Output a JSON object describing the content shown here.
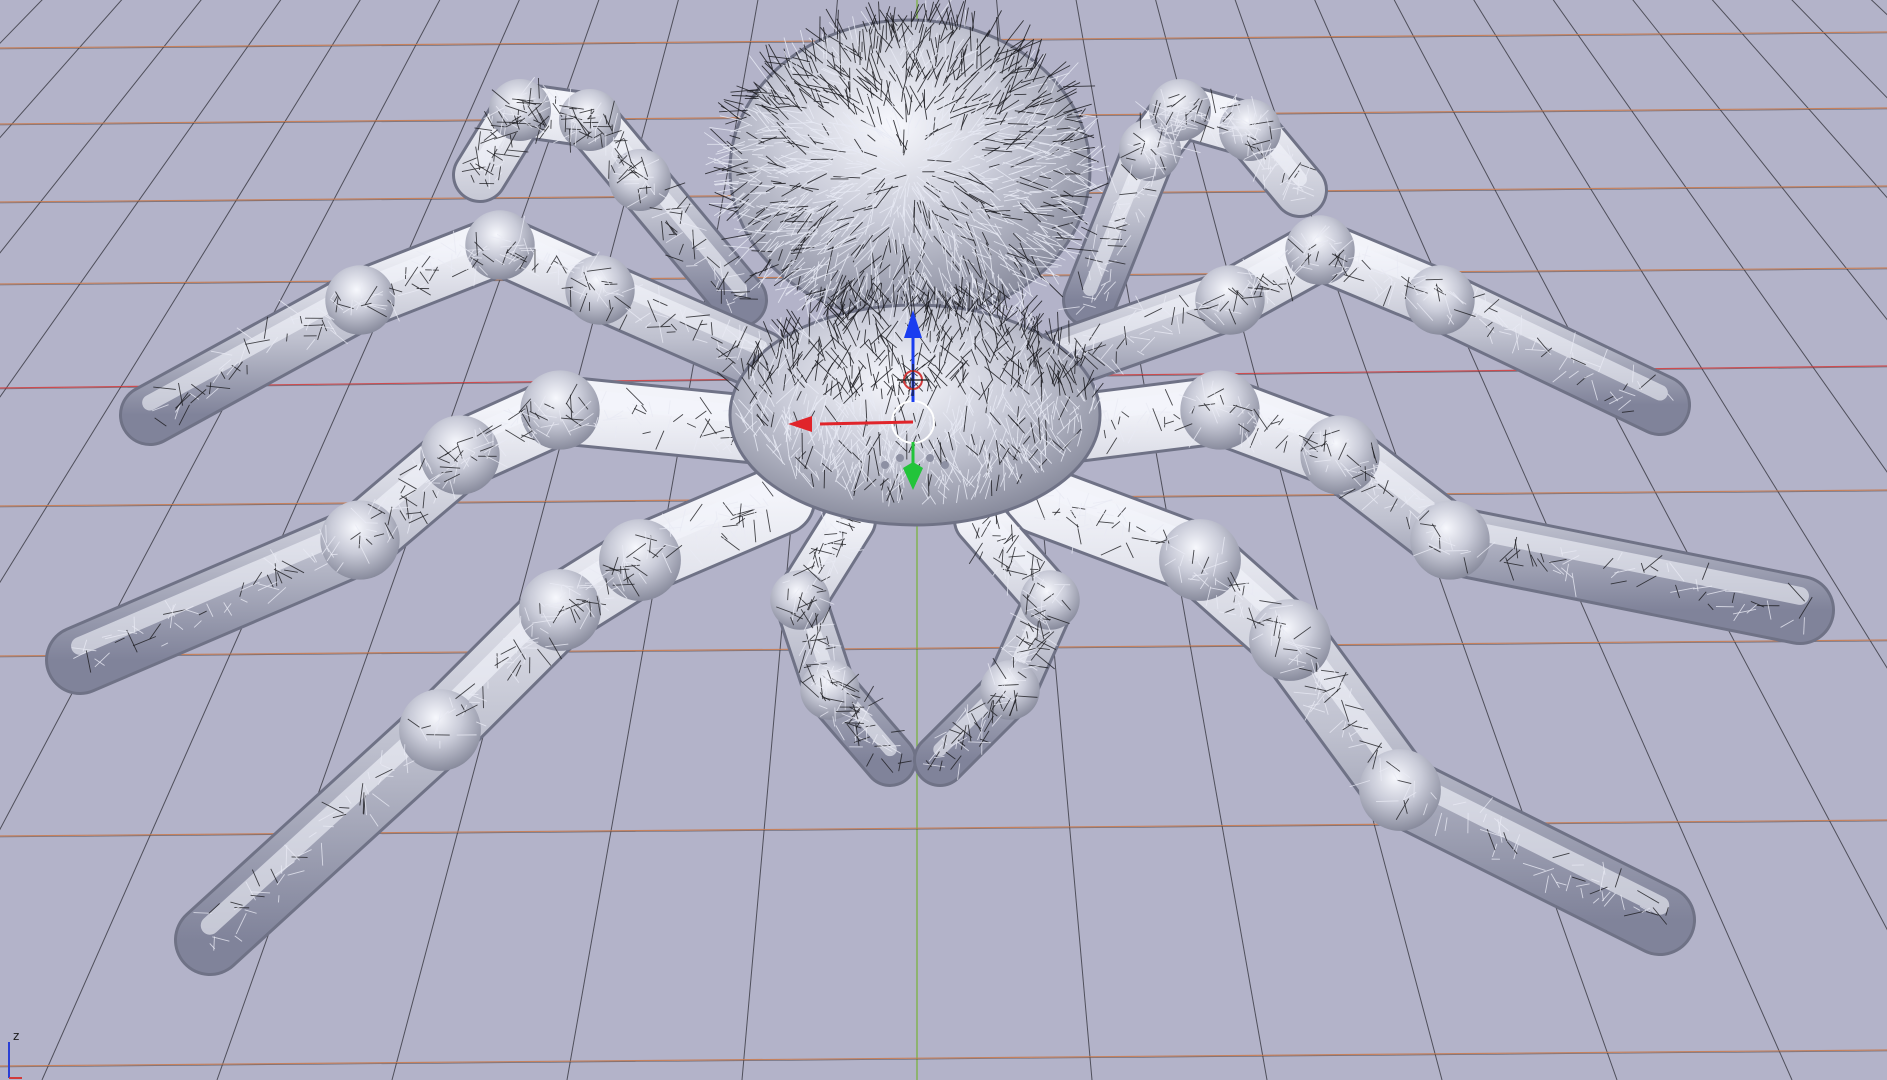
{
  "viewport": {
    "mode": "3d-perspective",
    "background_color": "#b3b3c9",
    "grid_color": "#2e2e36",
    "grid_accent_color": "#c9784a",
    "axis_x_color": "#d23a3a",
    "axis_y_color": "#7fb34a",
    "axis_z_color": "#2a3fd6"
  },
  "model": {
    "subject": "hairy tarantula",
    "icon": "spider-mesh-icon",
    "base_color": "#c7c9d6",
    "highlight_color": "#f4f5fb",
    "hair_color_dark": "#1a1a1e",
    "hair_color_light": "#e8eaf4"
  },
  "transform_gizmo": {
    "icon": "move-gizmo-icon",
    "x_color": "#e0242a",
    "y_color": "#22c43a",
    "z_color": "#1a3df0"
  },
  "axis_indicator": {
    "icon": "axis-orientation-icon",
    "label": "z",
    "z_color": "#2a3fd6",
    "x_color": "#d23a3a"
  }
}
